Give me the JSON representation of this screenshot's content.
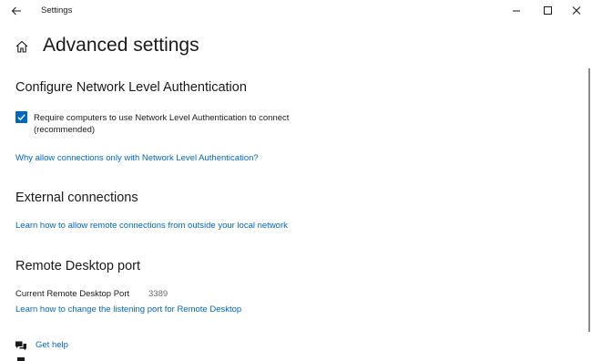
{
  "window": {
    "title": "Settings",
    "back_icon": "back-arrow-icon",
    "controls": [
      "minimize-icon",
      "maximize-icon",
      "close-icon"
    ]
  },
  "header": {
    "home_icon": "home-icon",
    "title": "Advanced settings"
  },
  "nla": {
    "heading": "Configure Network Level Authentication",
    "checkbox_label": "Require computers to use Network Level Authentication to connect (recommended)",
    "checkbox_checked": true,
    "link": "Why allow connections only with Network Level Authentication?"
  },
  "external": {
    "heading": "External connections",
    "link": "Learn how to allow remote connections from outside your local network"
  },
  "port": {
    "heading": "Remote Desktop port",
    "label": "Current Remote Desktop Port",
    "value": "3389",
    "link": "Learn how to change the listening port for Remote Desktop"
  },
  "help": {
    "icon": "get-help-icon",
    "label": "Get help"
  },
  "colors": {
    "accent": "#0067c0",
    "text": "#1a1a1a",
    "muted": "#6b6b6b"
  }
}
